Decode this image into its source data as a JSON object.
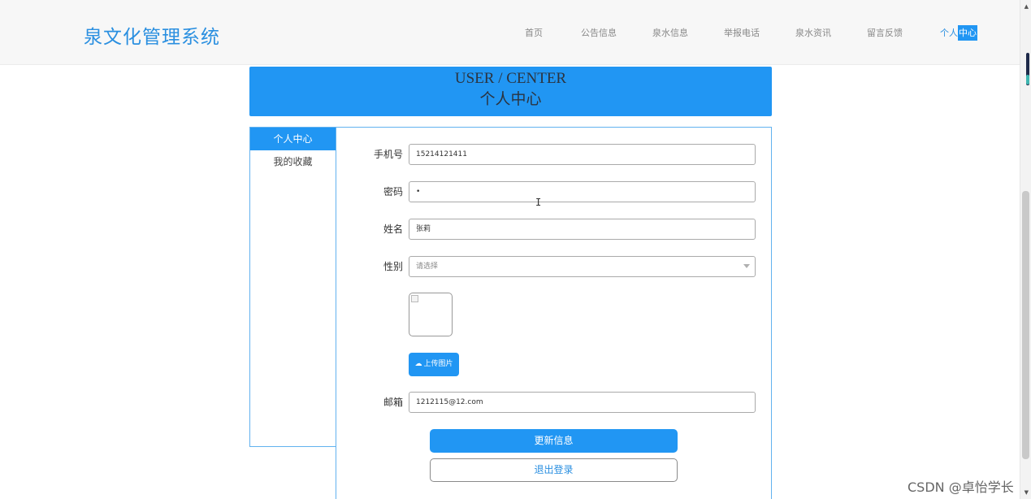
{
  "header": {
    "brand": "泉文化管理系统",
    "nav": [
      "首页",
      "公告信息",
      "泉水信息",
      "举报电话",
      "泉水资讯",
      "留言反馈"
    ],
    "active_nav_prefix": "个人",
    "active_nav_highlight": "中心"
  },
  "banner": {
    "title_en": "USER / CENTER",
    "title_cn": "个人中心"
  },
  "sidebar": {
    "items": [
      {
        "label": "个人中心",
        "active": true
      },
      {
        "label": "我的收藏",
        "active": false
      }
    ]
  },
  "form": {
    "phone_label": "手机号",
    "phone_value": "15214121411",
    "password_label": "密码",
    "password_value": "•",
    "name_label": "姓名",
    "name_value": "张莉",
    "gender_label": "性别",
    "gender_placeholder": "请选择",
    "upload_label": "上传图片",
    "email_label": "邮箱",
    "email_value": "1212115@12.com",
    "update_button": "更新信息",
    "logout_button": "退出登录"
  },
  "watermark": "CSDN @卓怡学长",
  "colors": {
    "accent": "#2196f3",
    "brand_text": "#2a8fe0",
    "panel_border": "#62b2ef"
  },
  "icons": {
    "upload": "cloud-upload-icon",
    "select": "chevron-down-icon",
    "cursor": "text-cursor-icon"
  }
}
